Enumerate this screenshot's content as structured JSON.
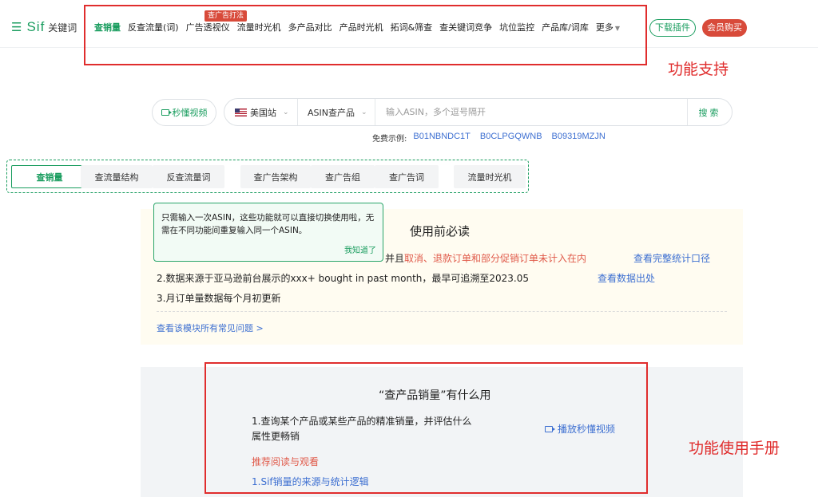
{
  "header": {
    "logo_mark": "☰",
    "logo_name": "Sif",
    "logo_sub": "关键词",
    "nav": [
      {
        "label": "查销量",
        "active": true
      },
      {
        "label": "反查流量(词)"
      },
      {
        "label": "广告透视仪"
      },
      {
        "label": "流量时光机"
      },
      {
        "label": "多产品对比"
      },
      {
        "label": "产品时光机"
      },
      {
        "label": "拓词&筛查"
      },
      {
        "label": "查关键词竞争"
      },
      {
        "label": "坑位监控"
      },
      {
        "label": "产品库/词库"
      },
      {
        "label": "更多"
      }
    ],
    "nav_badge": "查广告打法",
    "download_btn": "下载插件",
    "member_btn": "会员购买",
    "brand_color": "#1a9d5f",
    "accent_red": "#d84a3a"
  },
  "annotations": {
    "label_1": "功能支持",
    "label_2": "功能使用手册"
  },
  "search": {
    "video_btn": "秒懂视频",
    "site": "美国站",
    "mode": "ASIN查产品",
    "placeholder": "输入ASIN，多个逗号隔开",
    "submit": "搜索",
    "examples_label": "免费示例:",
    "examples": [
      "B01NBNDC1T",
      "B0CLPGQWNB",
      "B09319MZJN"
    ]
  },
  "tabs": [
    {
      "label": "查销量",
      "active": true
    },
    {
      "label": "查流量结构"
    },
    {
      "label": "反查流量词"
    },
    {
      "label": "查广告架构"
    },
    {
      "label": "查广告组"
    },
    {
      "label": "查广告词"
    },
    {
      "label": "流量时光机"
    }
  ],
  "tooltip": {
    "text": "只需输入一次ASIN，这些功能就可以直接切换使用啦，无需在不同功能间重复输入同一个ASIN。",
    "ok": "我知道了"
  },
  "notice": {
    "title": "使用前必读",
    "line1_tail_normal": "并且",
    "line1_tail_red": "取消、退款订单和部分促销订单未计入在内",
    "line1_link": "查看完整统计口径",
    "line2": "2.数据来源于亚马逊前台展示的xxx+ bought in past month，最早可追溯至2023.05",
    "line2_link": "查看数据出处",
    "line3": "3.月订单量数据每个月初更新",
    "faq_link": "查看该模块所有常见问题 >"
  },
  "manual": {
    "title": "“查产品销量”有什么用",
    "desc": "1.查询某个产品或某些产品的精准销量，并评估什么属性更畅销",
    "video": "播放秒懂视频",
    "recommend": "推荐阅读与观看",
    "link": "1.Sif销量的来源与统计逻辑"
  }
}
